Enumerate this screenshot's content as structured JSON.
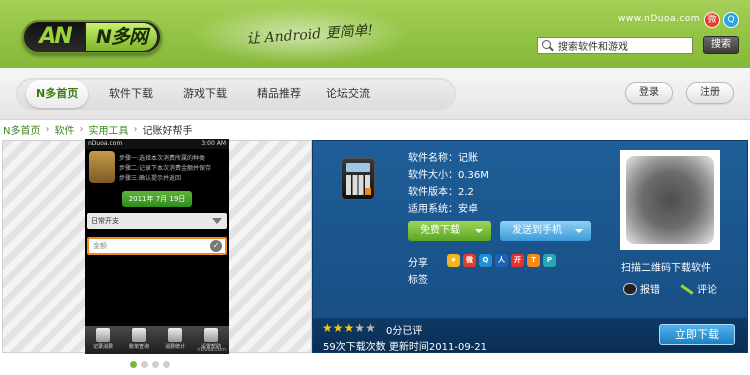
{
  "header": {
    "logo_mark": "AN",
    "logo_name": "N多网",
    "slogan": "让 Android 更简单!",
    "site_url": "www.nDuoa.com",
    "weibo_icon": "weibo-icon",
    "qq_icon": "qq-icon",
    "search": {
      "value": "搜索软件和游戏",
      "button": "搜索"
    }
  },
  "nav": {
    "items": [
      "N多首页",
      "软件下载",
      "游戏下载",
      "精品推荐",
      "论坛交流"
    ],
    "right_buttons": [
      "登录",
      "注册"
    ]
  },
  "breadcrumb": [
    "N多首页",
    "软件",
    "实用工具",
    "记账好帮手"
  ],
  "phone": {
    "status_left": "nDuoa.com",
    "status_right": "3:00 AM",
    "steps": [
      "步骤一:选择本次消费所属的种类",
      "步骤二:记录下本次消费金额并保存",
      "步骤三:确认提示并返回"
    ],
    "date": "2011年 7月 19日",
    "select": "日常开支",
    "input_placeholder": "金额",
    "toolbar": [
      "记录消费",
      "账单查询",
      "消费统计",
      "设置帮助"
    ],
    "watermark": "nDuoa.com"
  },
  "app": {
    "name_line": "软件名称：记账",
    "size_line": "软件大小：0.36M",
    "version_line": "软件版本：2.2",
    "system_line": "适用系统：安卓",
    "btn_download": "免费下载",
    "btn_phone": "发送到手机",
    "share_label": "分享",
    "tag_label": "标签",
    "share_icons": [
      "qzone-icon",
      "weibo-icon",
      "qq-weibo-icon",
      "renren-icon",
      "kaixin-icon",
      "tianya-icon",
      "pengyou-icon"
    ],
    "qr_caption": "扫描二维码下载软件",
    "report_link": "报错",
    "comment_link": "评论",
    "rating": {
      "stars": 3,
      "max": 5,
      "score": "0分已评"
    },
    "stats": "59次下载次数 更新时间2011-09-21",
    "download_button": "立即下载"
  },
  "carousel": {
    "count": 4,
    "active": 0
  }
}
